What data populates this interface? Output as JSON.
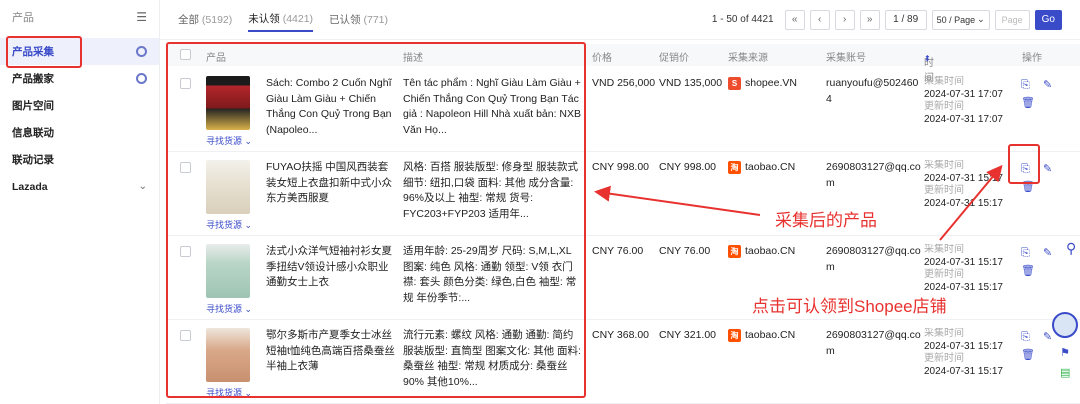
{
  "sidebar": {
    "header": "产品",
    "items": [
      {
        "label": "产品采集",
        "active": true,
        "icon": "gear-icon"
      },
      {
        "label": "产品搬家",
        "active": false,
        "icon": "gear-icon"
      },
      {
        "label": "图片空间",
        "active": false
      },
      {
        "label": "信息联动",
        "active": false
      },
      {
        "label": "联动记录",
        "active": false
      },
      {
        "label": "Lazada",
        "active": false,
        "icon": "chevron-down-icon"
      }
    ]
  },
  "tabs": [
    {
      "label": "全部",
      "count": "(5192)"
    },
    {
      "label": "未认领",
      "count": "(4421)"
    },
    {
      "label": "已认领",
      "count": "(771)"
    }
  ],
  "pagination": {
    "range": "1 - 50 of 4421",
    "page": "1 / 89",
    "page_size": "50 / Page",
    "page_label": "Page",
    "go": "Go"
  },
  "columns": {
    "product": "产品",
    "desc": "描述",
    "price": "价格",
    "promo": "促销价",
    "source": "采集来源",
    "account": "采集账号",
    "time": "时间",
    "ops": "操作"
  },
  "rows": [
    {
      "title": "Sách: Combo 2 Cuốn Nghĩ Giàu Làm Giàu + Chiến Thắng Con Quỷ Trong Bạn (Napoleo...",
      "desc": "Tên tác phẩm : Nghĩ Giàu Làm Giàu + Chiến Thắng Con Quỷ Trong Bạn Tác giả : Napoleon Hill Nhà xuất bản: NXB Văn Họ...",
      "price": "VND 256,000",
      "promo": "VND 135,000",
      "source": "shopee.VN",
      "account": "ruanyoufu@5024604",
      "collect_label": "采集时间",
      "collect_time": "2024-07-31 17:07",
      "update_label": "更新时间",
      "update_time": "2024-07-31 17:07",
      "find": "寻找货源"
    },
    {
      "title": "FUYAO扶摇 中国风西装套装女短上衣盘扣新中式小众东方美西服夏",
      "desc": "风格: 百搭 服装版型: 修身型 服装款式细节: 纽扣,口袋 面料: 其他 成分含量: 96%及以上 袖型: 常规 货号: FYC203+FYP203 适用年...",
      "price": "CNY 998.00",
      "promo": "CNY 998.00",
      "source": "taobao.CN",
      "account": "2690803127@qq.com",
      "collect_label": "采集时间",
      "collect_time": "2024-07-31 15:17",
      "update_label": "更新时间",
      "update_time": "2024-07-31 15:17",
      "find": "寻找货源"
    },
    {
      "title": "法式小众洋气短袖衬衫女夏季扭结V领设计感小众职业通勤女士上衣",
      "desc": "适用年龄: 25-29周岁 尺码: S,M,L,XL 图案: 纯色 风格: 通勤 领型: V领 衣门襟: 套头 颜色分类: 绿色,白色 袖型: 常规 年份季节:...",
      "price": "CNY 76.00",
      "promo": "CNY 76.00",
      "source": "taobao.CN",
      "account": "2690803127@qq.com",
      "collect_label": "采集时间",
      "collect_time": "2024-07-31 15:17",
      "update_label": "更新时间",
      "update_time": "2024-07-31 15:17",
      "find": "寻找货源"
    },
    {
      "title": "鄂尔多斯市产夏季女士冰丝短袖t恤纯色高端百搭桑蚕丝半袖上衣薄",
      "desc": "流行元素: 螺纹 风格: 通勤 通勤: 简约 服装版型: 直筒型 图案文化: 其他 面料: 桑蚕丝 袖型: 常规 材质成分: 桑蚕丝90% 其他10%...",
      "price": "CNY 368.00",
      "promo": "CNY 321.00",
      "source": "taobao.CN",
      "account": "2690803127@qq.com",
      "collect_label": "采集时间",
      "collect_time": "2024-07-31 15:17",
      "update_label": "更新时间",
      "update_time": "2024-07-31 15:17",
      "find": "寻找货源"
    }
  ],
  "annotations": {
    "collected": "采集后的产品",
    "claim": "点击可认领到Shopee店铺"
  },
  "colors": {
    "accent": "#3a4bc9",
    "annotation": "#e8322f",
    "shopee": "#ee4d2d",
    "taobao": "#ff5000"
  }
}
